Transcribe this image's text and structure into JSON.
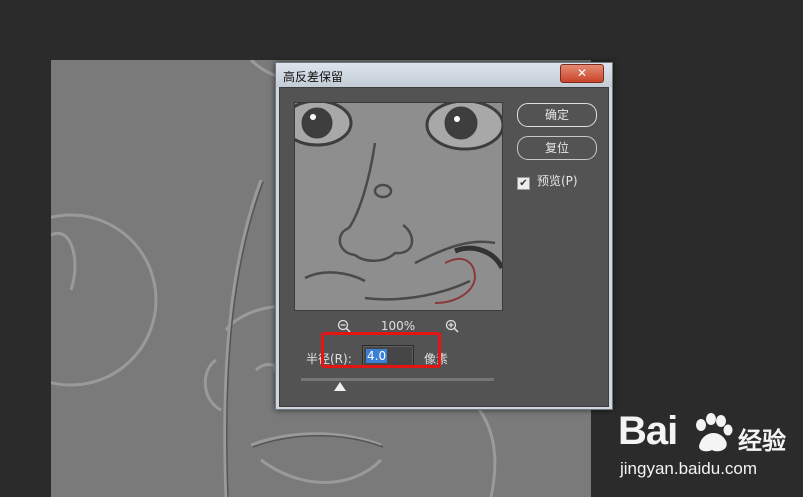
{
  "dialog": {
    "title": "高反差保留",
    "close_label": "✕",
    "ok_label": "确定",
    "reset_label": "复位",
    "preview_label": "预览(P)",
    "preview_checked": true,
    "zoom_level": "100%",
    "radius_label": "半径(R):",
    "radius_value": "4.0",
    "radius_unit": "像素",
    "slider_value_fraction": 0.2
  },
  "icons": {
    "zoom_out": "zoom-out-icon",
    "zoom_in": "zoom-in-icon",
    "check": "check-icon"
  },
  "watermark": {
    "brand": "Bai",
    "brand_suffix": "经验",
    "url": "jingyan.baidu.com"
  },
  "colors": {
    "highlight": "#e21414",
    "selection": "#3a80d6",
    "dialog_bg": "#535353"
  }
}
